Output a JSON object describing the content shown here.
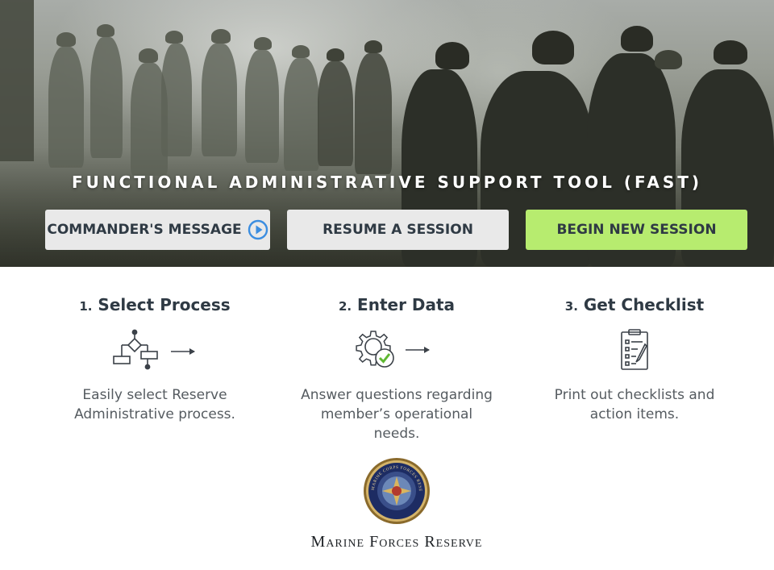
{
  "hero": {
    "title": "FUNCTIONAL ADMINISTRATIVE SUPPORT TOOL (FAST)"
  },
  "buttons": {
    "commander": {
      "label": "COMMANDER'S MESSAGE",
      "icon": "play-circle-icon"
    },
    "resume": {
      "label": "RESUME A SESSION"
    },
    "begin": {
      "label": "BEGIN NEW SESSION"
    }
  },
  "steps": [
    {
      "number": "1.",
      "title": "Select Process",
      "icon": "flowchart-icon",
      "line1": "Easily select Reserve",
      "line2": "Administrative process."
    },
    {
      "number": "2.",
      "title": "Enter Data",
      "icon": "gear-check-icon",
      "line1": "Answer questions regarding",
      "line2": "member’s operational needs."
    },
    {
      "number": "3.",
      "title": "Get Checklist",
      "icon": "clipboard-checklist-icon",
      "line1": "Print out checklists and",
      "line2": "action items."
    }
  ],
  "footer": {
    "seal_text": "U.S. MARINE CORPS FORCES RESERVE",
    "org_name": "Marine Forces Reserve"
  },
  "colors": {
    "begin_button": "#b7ec6f",
    "neutral_button": "#e9e9e9",
    "play_icon": "#3b8de0",
    "check": "#5fb832"
  }
}
